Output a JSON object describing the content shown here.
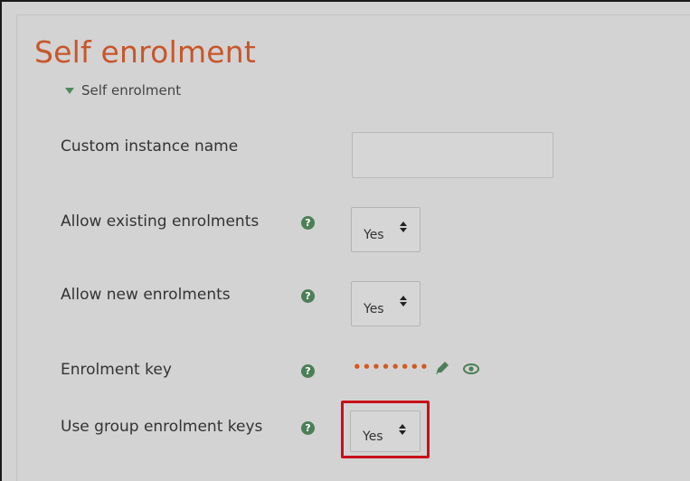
{
  "page": {
    "title": "Self enrolment",
    "section_label": "Self enrolment"
  },
  "form": {
    "fields": [
      {
        "label": "Custom instance name",
        "type": "text",
        "value": ""
      },
      {
        "label": "Allow existing enrolments",
        "type": "select",
        "value": "Yes",
        "help": "?"
      },
      {
        "label": "Allow new enrolments",
        "type": "select",
        "value": "Yes",
        "help": "?"
      },
      {
        "label": "Enrolment key",
        "type": "password",
        "value": "••••••••",
        "help": "?"
      },
      {
        "label": "Use group enrolment keys",
        "type": "select",
        "value": "Yes",
        "help": "?"
      }
    ]
  },
  "icons": {
    "section_toggle": "triangle-down-icon",
    "help": "question-circle-icon",
    "edit": "pencil-icon",
    "reveal": "eye-icon",
    "select_arrows": "sort-arrows-icon"
  },
  "colors": {
    "title": "#c8562b",
    "accent_green": "#4c7f57",
    "password_dots": "#d2581f",
    "highlight_box": "#c8101a"
  }
}
